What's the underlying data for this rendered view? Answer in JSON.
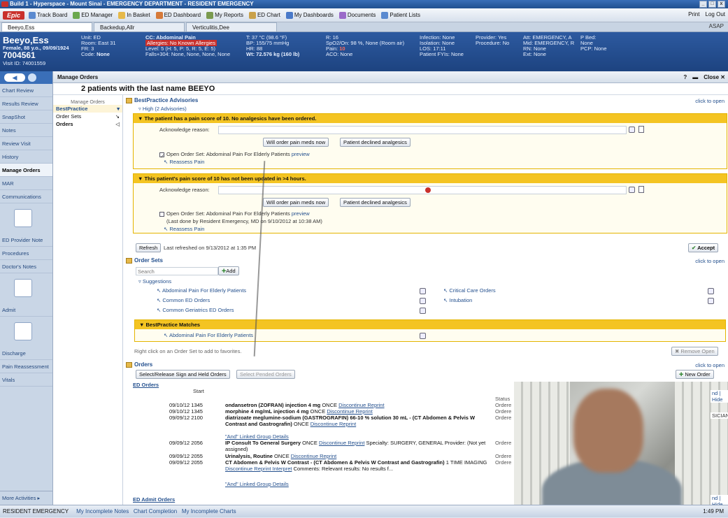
{
  "window": {
    "title": "Build 1 - Hyperspace - Mount Sinai - EMERGENCY DEPARTMENT - RESIDENT EMERGENCY"
  },
  "toolbar": {
    "brand": "Epic",
    "items": [
      "Track Board",
      "ED Manager",
      "In Basket",
      "ED Dashboard",
      "My Reports",
      "ED Chart",
      "My Dashboards",
      "Documents",
      "Patient Lists"
    ],
    "print": "Print",
    "logout": "Log Out"
  },
  "tabs": [
    "Beeyo,Ess",
    "Backedup,Allr",
    "Verticulitis,Dee"
  ],
  "asap": "ASAP",
  "patient": {
    "name": "Beeyo,Ess",
    "sub": "Female, 88 y.o., 09/09/1924",
    "mrn": "7004561",
    "visit": "Visit ID: 74001559",
    "unit": "Unit: ED",
    "room": "Room: East 31",
    "fr": "FR: 3",
    "code_label": "Code:",
    "code": "None",
    "cc": "CC: Abdominal Pain",
    "allergies": "Allergies: No Known Allergies",
    "level": "Level: 5 (H: 5, P: 5, R: 5, E: 5)",
    "falls": "Falls+304: None, None, None, None",
    "temp": "T: 37 °C (98.6 °F)",
    "bp": "BP: 155/75 mmHg",
    "hr": "HR: 88",
    "wt": "Wt: 72.576 kg (160 lb)",
    "rr": "R: 16",
    "spo2": "SpO2/On: 98 %, None (Room air)",
    "pain_label": "Pain:",
    "pain": "10",
    "aco": "ACO: None",
    "infection": "Infection: None",
    "isolation": "Isolation: None",
    "los": "LOS: 17:11",
    "fyis": "Patient FYIs: None",
    "provider": "Provider: Yes",
    "procedure": "Procedure: No",
    "att": "Att: EMERGENCY, A",
    "mid": "Mid: EMERGENCY, R",
    "rn": "RN: None",
    "ext": "Ext: None",
    "pbed": "P Bed:",
    "pbed_val": "None",
    "pcp": "PCP: None"
  },
  "nav": {
    "items": [
      "Chart Review",
      "Results Review",
      "SnapShot",
      "Notes",
      "Review Visit",
      "History",
      "Manage Orders",
      "MAR",
      "Communications"
    ],
    "big1": "ED Provider Note",
    "items2": [
      "Procedures",
      "Doctor's Notes"
    ],
    "big2": "Admit",
    "big3": "Discharge",
    "items3": [
      "Pain Reassessment",
      "Vitals"
    ],
    "more": "More Activities"
  },
  "header": {
    "title": "Manage Orders",
    "close": "Close"
  },
  "patients_msg": "2 patients with the last name BEEYO",
  "subnav": {
    "title": "Manage Orders",
    "items": [
      "BestPractice",
      "Order Sets",
      "Orders"
    ]
  },
  "bpa": {
    "title": "BestPractice Advisories",
    "open": "click to open",
    "high": "High (2 Advisories)",
    "adv1": {
      "title": "The patient has a pain score of 10. No analgesics have been ordered.",
      "ack": "Acknowledge reason:",
      "b1": "Will order pain meds now",
      "b2": "Patient declined analgesics",
      "os": "Open Order Set: Abdominal Pain For Elderly Patients",
      "preview": "preview",
      "reassess": "Reassess Pain"
    },
    "adv2": {
      "title": "This patient's pain score of 10 has not been updated in >4 hours.",
      "ack": "Acknowledge reason:",
      "b1": "Will order pain meds now",
      "b2": "Patient declined analgesics",
      "os": "Open Order Set: Abdominal Pain For Elderly Patients",
      "preview": "preview",
      "last": "(Last done by Resident Emergency, MD on 9/10/2012 at 10:38 AM)",
      "reassess": "Reassess Pain"
    },
    "refresh": "Refresh",
    "refreshed": "Last refreshed on 9/13/2012 at 1:35 PM",
    "accept": "Accept"
  },
  "ordersets": {
    "title": "Order Sets",
    "open": "click to open",
    "search_ph": "Search",
    "add": "Add",
    "suggestions": "Suggestions",
    "left": [
      "Abdominal Pain For Elderly Patients",
      "Common ED Orders",
      "Common Geriatrics ED Orders"
    ],
    "right": [
      "Critical Care Orders",
      "Intubation"
    ],
    "bpm": "BestPractice Matches",
    "bpm_item": "Abdominal Pain For Elderly Patients",
    "hint": "Right click on an Order Set to add to favorites.",
    "remove": "Remove Open"
  },
  "orders": {
    "title": "Orders",
    "open": "click to open",
    "btn1": "Select/Release Sign and Held Orders",
    "btn2": "Select Pended Orders",
    "new": "New Order",
    "ed": "ED Orders",
    "start": "Start",
    "status": "Status",
    "hide": "nd | Hide",
    "rows": [
      {
        "time": "09/10/12 1345",
        "name": "ondansetron (ZOFRAN) injection 4 mg",
        "rest": " ONCE",
        "links": "Discontinue Reprint",
        "status": "Ordere"
      },
      {
        "time": "09/10/12 1345",
        "name": "morphine 4 mg/mL injection 4 mg",
        "rest": " ONCE",
        "links": "Discontinue Reprint",
        "status": "Ordere"
      },
      {
        "time": "09/09/12 2100",
        "name": "diatrizoate meglumine-sodium (GASTROGRAFIN) 66-10 % solution 30 mL - (CT Abdomen & Pelvis W Contrast and Gastrografin)",
        "rest": " ONCE",
        "links": "Discontinue Reprint",
        "status": "Ordere"
      },
      {
        "time": "09/09/12 2056",
        "name": "IP Consult To General Surgery",
        "rest": " ONCE",
        "links": "Discontinue Reprint",
        "extra": "Specialty: SURGERY, GENERAL Provider: (Not yet assigned)",
        "status": "Ordere"
      },
      {
        "time": "09/09/12 2055",
        "name": "Urinalysis, Routine",
        "rest": " ONCE",
        "links": "Discontinue Reprint",
        "status": "Ordere"
      },
      {
        "time": "09/09/12 2055",
        "name": "CT Abdomen & Pelvis W Contrast - (CT Abdomen & Pelvis W Contrast and Gastrografin)",
        "rest": " 1 TIME IMAGING",
        "links": "Discontinue Reprint Interpret",
        "extra": "Comments: Relevant results: No results f...",
        "status": "Ordere"
      }
    ],
    "linked": "\"And\" Linked Group Details",
    "sician": "SICIAN",
    "admit": "ED Admit Orders",
    "hide2": "nd | Hide"
  },
  "bottom": {
    "left": "RESIDENT EMERGENCY",
    "notes": "My Incomplete Notes",
    "charts": "Chart Completion",
    "incomplete": "My Incomplete Charts",
    "time": "1:49 PM"
  }
}
